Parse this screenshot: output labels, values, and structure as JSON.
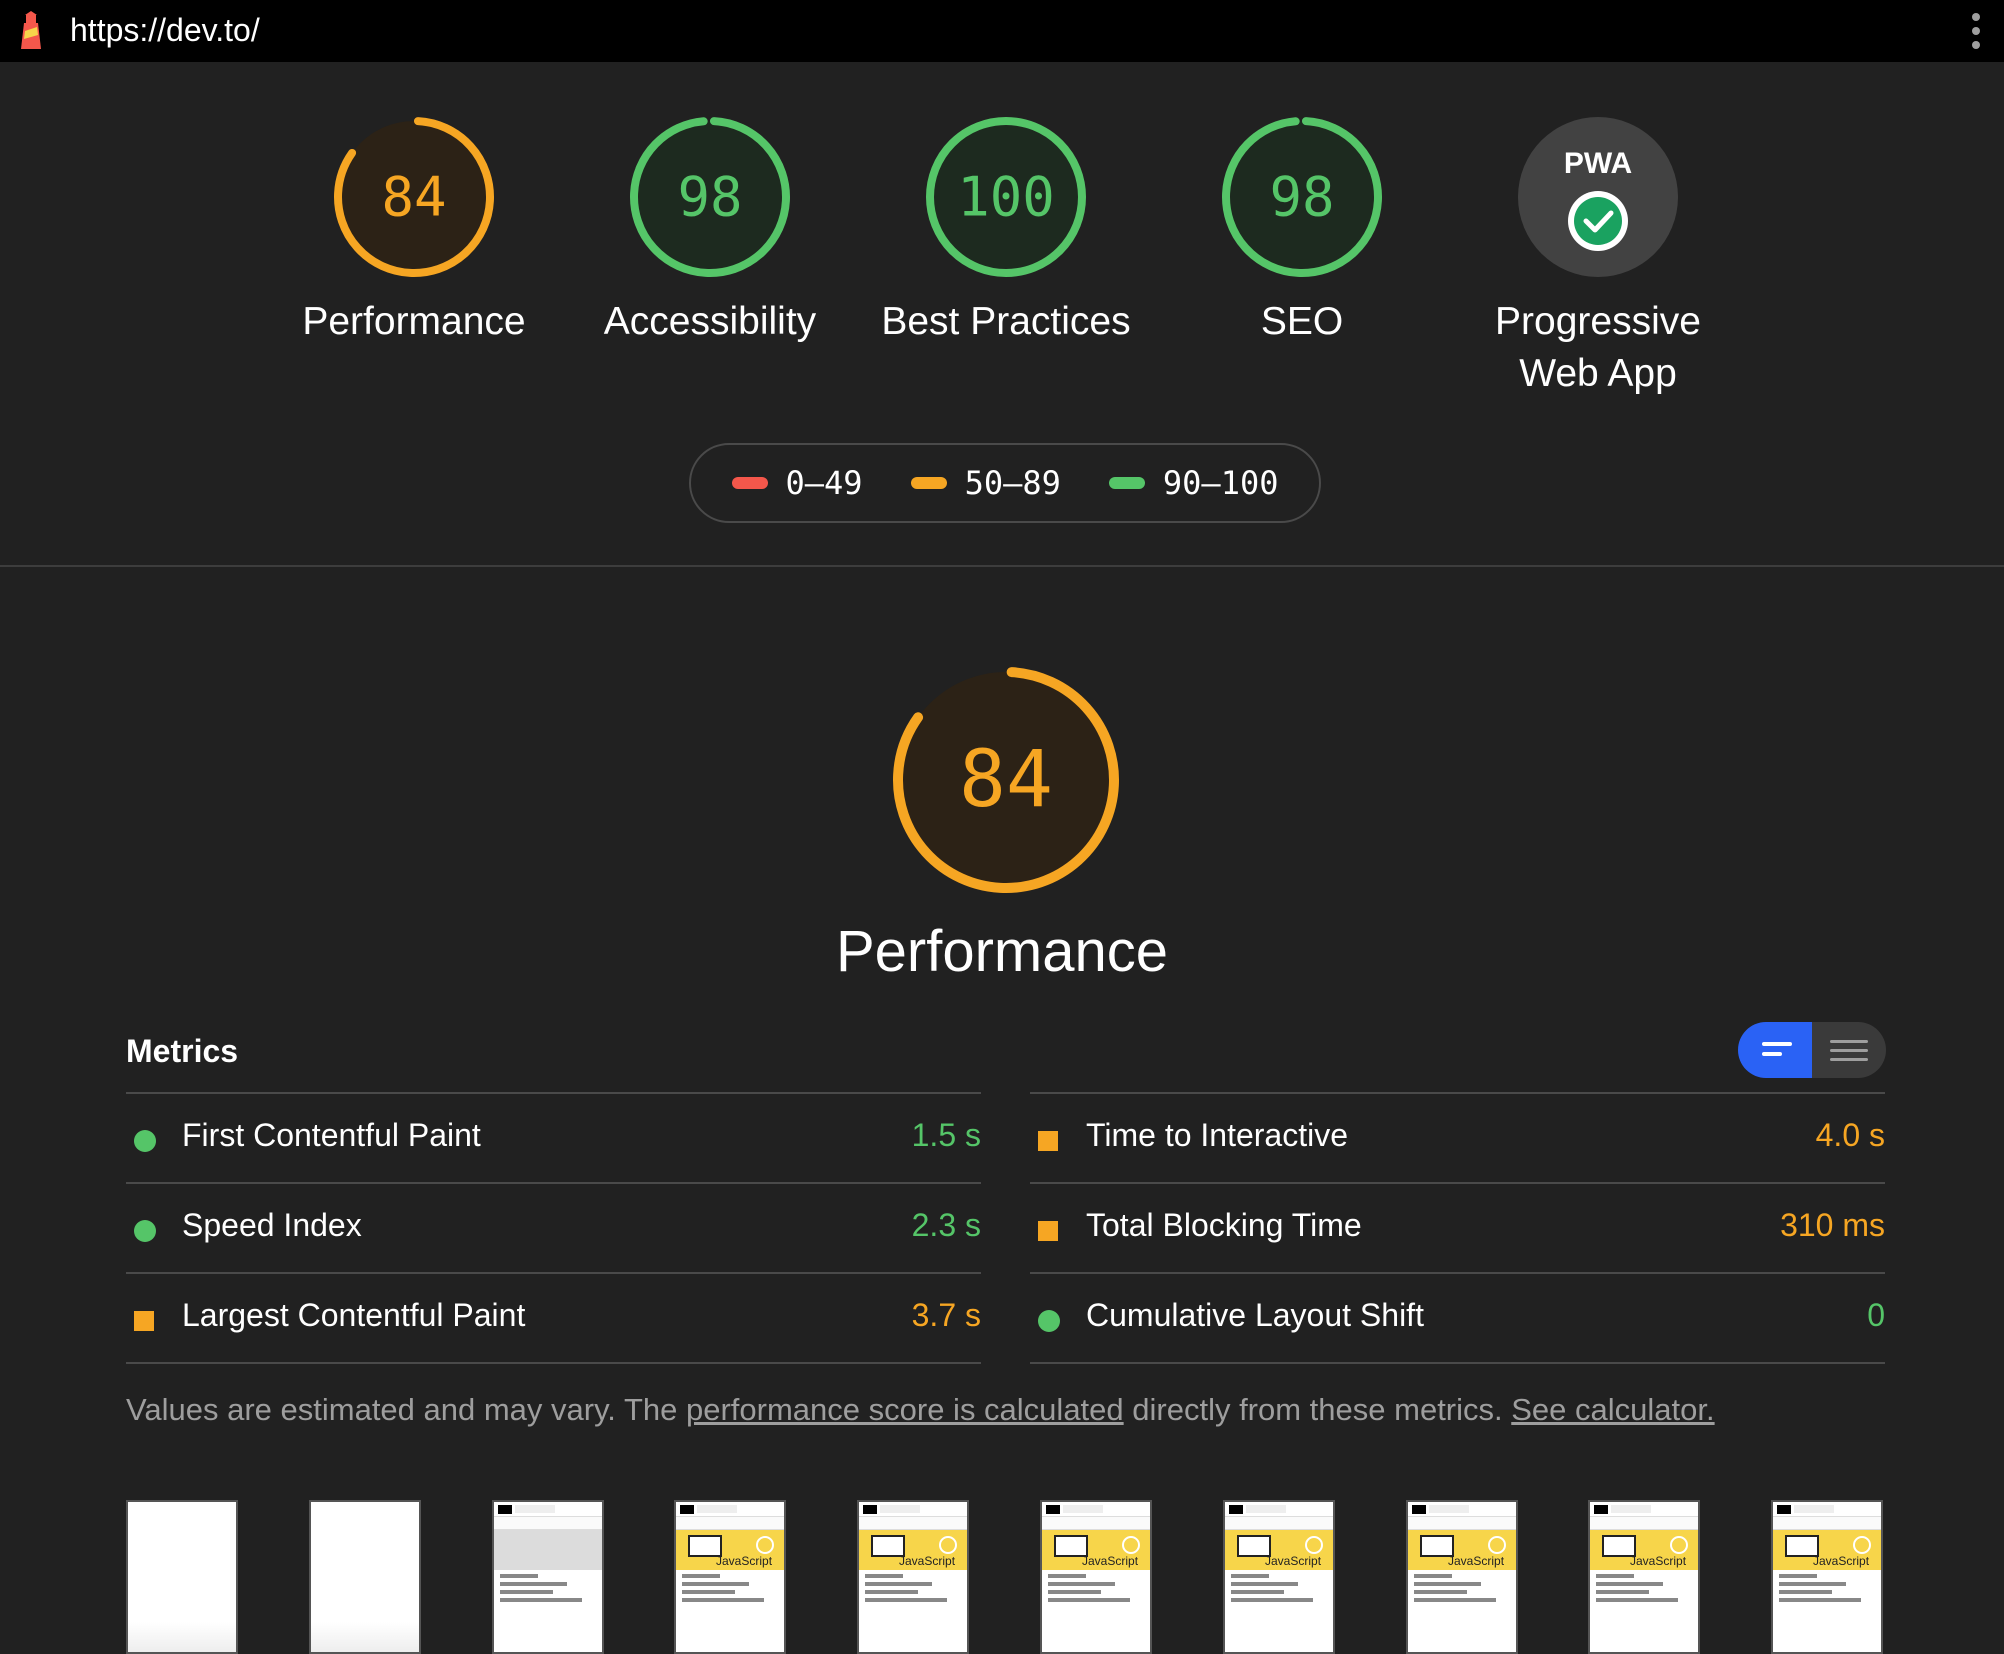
{
  "topbar": {
    "url": "https://dev.to/",
    "logo_icon": "lighthouse-icon",
    "menu_icon": "kebab-menu-icon"
  },
  "colors": {
    "pass": "#55c568",
    "average": "#f6a623",
    "fail": "#f4574b",
    "toggle_active": "#2a62f5"
  },
  "gauges": [
    {
      "id": "performance",
      "score": "84",
      "label": "Performance",
      "status": "average"
    },
    {
      "id": "accessibility",
      "score": "98",
      "label": "Accessibility",
      "status": "pass"
    },
    {
      "id": "best-practices",
      "score": "100",
      "label": "Best Practices",
      "status": "pass"
    },
    {
      "id": "seo",
      "score": "98",
      "label": "SEO",
      "status": "pass"
    },
    {
      "id": "pwa",
      "label_line1": "Progressive",
      "label_line2": "Web App",
      "badge_text": "PWA",
      "badge_icon": "checkmark-icon"
    }
  ],
  "legend": [
    {
      "range": "0–49",
      "status": "fail"
    },
    {
      "range": "50–89",
      "status": "average"
    },
    {
      "range": "90–100",
      "status": "pass"
    }
  ],
  "main": {
    "score": "84",
    "title": "Performance"
  },
  "metrics": {
    "title": "Metrics",
    "toggle_icons": [
      "compact-view-icon",
      "expanded-view-icon"
    ],
    "left": [
      {
        "name": "First Contentful Paint",
        "value": "1.5 s",
        "status": "pass"
      },
      {
        "name": "Speed Index",
        "value": "2.3 s",
        "status": "pass"
      },
      {
        "name": "Largest Contentful Paint",
        "value": "3.7 s",
        "status": "average"
      }
    ],
    "right": [
      {
        "name": "Time to Interactive",
        "value": "4.0 s",
        "status": "average"
      },
      {
        "name": "Total Blocking Time",
        "value": "310 ms",
        "status": "average"
      },
      {
        "name": "Cumulative Layout Shift",
        "value": "0",
        "status": "pass"
      }
    ],
    "note_part1": "Values are estimated and may vary. The ",
    "note_link1": "performance score is calculated",
    "note_part2": " directly from these metrics. ",
    "note_link2": "See calculator."
  },
  "filmstrip": {
    "frames": [
      "blank",
      "blank",
      "loading",
      "loaded",
      "loaded",
      "loaded",
      "loaded",
      "loaded",
      "loaded",
      "loaded"
    ],
    "banner_text": "JavaScript"
  }
}
